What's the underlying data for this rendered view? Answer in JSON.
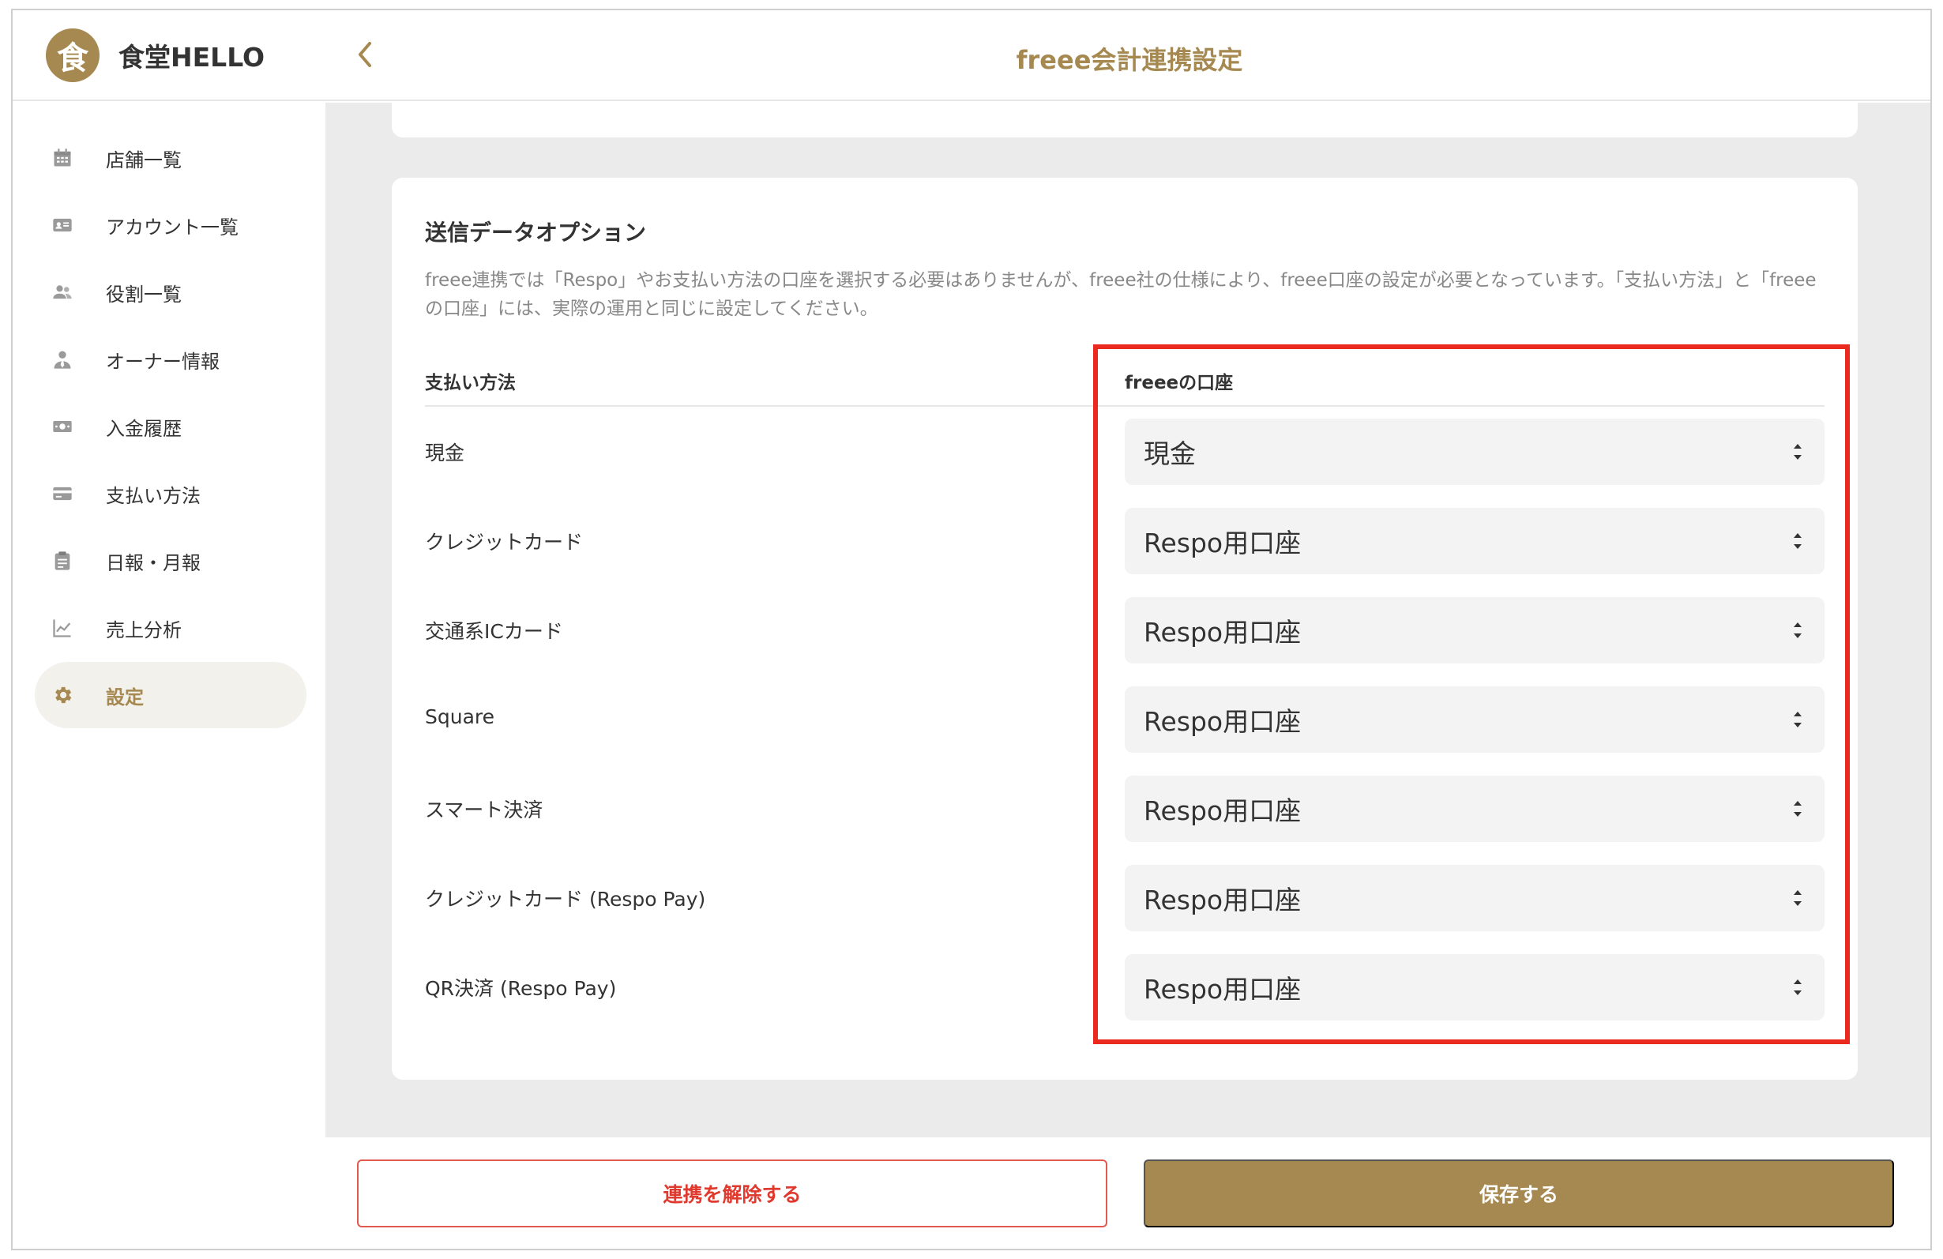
{
  "brand": {
    "logo_char": "食",
    "name": "食堂HELLO"
  },
  "header": {
    "title": "freee会計連携設定"
  },
  "sidebar": {
    "items": [
      {
        "label": "店舗一覧",
        "icon": "calendar-icon"
      },
      {
        "label": "アカウント一覧",
        "icon": "id-card-icon"
      },
      {
        "label": "役割一覧",
        "icon": "people-icon"
      },
      {
        "label": "オーナー情報",
        "icon": "person-tie-icon"
      },
      {
        "label": "入金履歴",
        "icon": "money-icon"
      },
      {
        "label": "支払い方法",
        "icon": "credit-card-icon"
      },
      {
        "label": "日報・月報",
        "icon": "clipboard-icon"
      },
      {
        "label": "売上分析",
        "icon": "chart-line-icon"
      },
      {
        "label": "設定",
        "icon": "gear-icon",
        "active": true
      }
    ]
  },
  "section": {
    "title": "送信データオプション",
    "description": "freee連携では「Respo」やお支払い方法の口座を選択する必要はありませんが、freee社の仕様により、freee口座の設定が必要となっています。「支払い方法」と「freeeの口座」には、実際の運用と同じに設定してください。",
    "col_payment": "支払い方法",
    "col_account": "freeeの口座"
  },
  "rows": [
    {
      "method": "現金",
      "account": "現金"
    },
    {
      "method": "クレジットカード",
      "account": "Respo用口座"
    },
    {
      "method": "交通系ICカード",
      "account": "Respo用口座"
    },
    {
      "method": "Square",
      "account": "Respo用口座"
    },
    {
      "method": "スマート決済",
      "account": "Respo用口座"
    },
    {
      "method": "クレジットカード (Respo Pay)",
      "account": "Respo用口座"
    },
    {
      "method": "QR決済 (Respo Pay)",
      "account": "Respo用口座"
    }
  ],
  "footer": {
    "unlink_label": "連携を解除する",
    "save_label": "保存する"
  },
  "colors": {
    "brand": "#a58951",
    "danger": "#e0392e",
    "highlight": "#ea2a1e"
  }
}
